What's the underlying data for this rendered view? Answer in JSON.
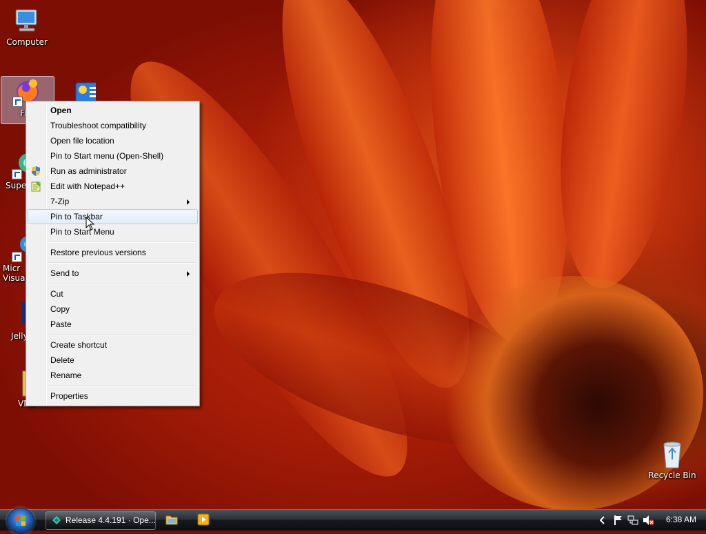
{
  "desktop": {
    "icons": [
      {
        "label": "Computer"
      },
      {
        "label": "Fire"
      },
      {
        "label": ""
      },
      {
        "label": "Super"
      },
      {
        "label": "Micr Visual"
      },
      {
        "label": "Jelly"
      },
      {
        "label": "VM1"
      },
      {
        "label": "Recycle Bin"
      }
    ]
  },
  "context_menu": {
    "items": [
      {
        "label": "Open"
      },
      {
        "label": "Troubleshoot compatibility"
      },
      {
        "label": "Open file location"
      },
      {
        "label": "Pin to Start menu (Open-Shell)"
      },
      {
        "label": "Run as administrator",
        "icon": "uac-shield-icon"
      },
      {
        "label": "Edit with Notepad++",
        "icon": "notepad-plus-plus-icon"
      },
      {
        "label": "7-Zip"
      },
      {
        "label": "Pin to Taskbar"
      },
      {
        "label": "Pin to Start Menu"
      },
      {
        "label": "Restore previous versions"
      },
      {
        "label": "Send to"
      },
      {
        "label": "Cut"
      },
      {
        "label": "Copy"
      },
      {
        "label": "Paste"
      },
      {
        "label": "Create shortcut"
      },
      {
        "label": "Delete"
      },
      {
        "label": "Rename"
      },
      {
        "label": "Properties"
      }
    ],
    "hovered": "Pin to Taskbar"
  },
  "taskbar": {
    "start_icon": "windows-orb-icon",
    "window_button": "Release 4.4.191 · Ope...",
    "clock": "6:38 AM",
    "quick_launch": [
      "file-explorer-icon",
      "media-player-icon"
    ],
    "tray": [
      "chevron-left-icon",
      "flag-icon",
      "network-icon",
      "volume-muted-icon"
    ]
  },
  "colors": {
    "menu_bg": "#f0f0f0",
    "hover_border": "#aecbef",
    "wallpaper_accent": "#c2320c"
  }
}
